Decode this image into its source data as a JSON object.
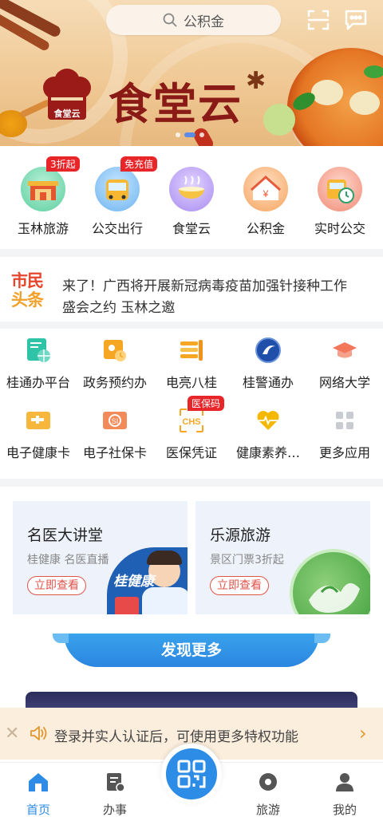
{
  "header": {
    "search_text": "公积金",
    "banner_title": "食堂云",
    "logo_text": "食堂云"
  },
  "quick_services": [
    {
      "label": "玉林旅游",
      "badge": "3折起"
    },
    {
      "label": "公交出行",
      "badge": "免充值"
    },
    {
      "label": "食堂云",
      "badge": ""
    },
    {
      "label": "公积金",
      "badge": ""
    },
    {
      "label": "实时公交",
      "badge": ""
    }
  ],
  "news": {
    "logo_line1": "市民",
    "logo_line2": "头条",
    "items": [
      "来了！广西将开展新冠病毒疫苗加强针接种工作",
      "盛会之约 玉林之邀"
    ]
  },
  "apps": [
    {
      "label": "桂通办平台",
      "badge": ""
    },
    {
      "label": "政务预约办",
      "badge": ""
    },
    {
      "label": "电亮八桂",
      "badge": ""
    },
    {
      "label": "桂警通办",
      "badge": ""
    },
    {
      "label": "网络大学",
      "badge": ""
    },
    {
      "label": "电子健康卡",
      "badge": ""
    },
    {
      "label": "电子社保卡",
      "badge": ""
    },
    {
      "label": "医保凭证",
      "badge": "医保码"
    },
    {
      "label": "健康素养…",
      "badge": ""
    },
    {
      "label": "更多应用",
      "badge": ""
    }
  ],
  "cards": [
    {
      "title": "名医大讲堂",
      "subtitle": "桂健康 名医直播",
      "button": "立即查看",
      "art_text": "桂健康"
    },
    {
      "title": "乐源旅游",
      "subtitle": "景区门票3折起",
      "button": "立即查看"
    }
  ],
  "discover": {
    "title": "发现更多"
  },
  "notice": {
    "text": "登录并实人认证后，可使用更多特权功能",
    "close": "✕",
    "arrow": "›"
  },
  "tabbar": [
    {
      "label": "首页",
      "active": true
    },
    {
      "label": "办事",
      "active": false
    },
    {
      "label": "旅游",
      "active": false
    },
    {
      "label": "我的",
      "active": false
    }
  ],
  "colors": {
    "accent": "#2f8ce6",
    "badge_red": "#e8262a",
    "banner_title": "#8a1a16"
  }
}
